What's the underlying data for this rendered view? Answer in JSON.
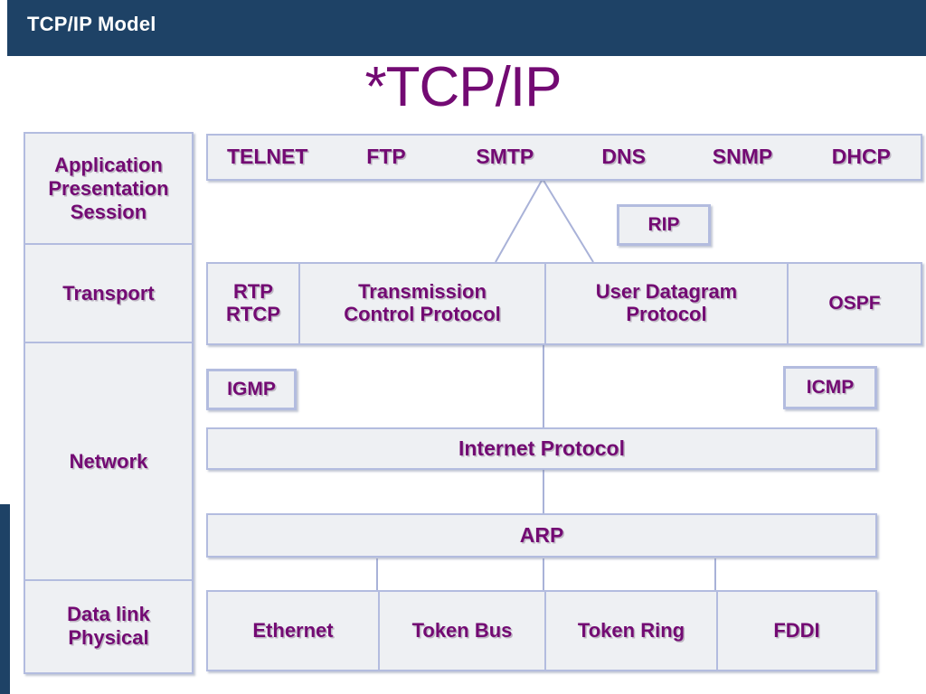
{
  "header": {
    "title": "TCP/IP Model",
    "bar_color": "#1e4266",
    "accent_color": "#730a73"
  },
  "slide": {
    "title": "*TCP/IP"
  },
  "osi_stack": {
    "name": "osi-layer-stack",
    "rows": [
      {
        "label": "Application\nPresentation\nSession"
      },
      {
        "label": "Transport"
      },
      {
        "label": "Network"
      },
      {
        "label": "Data link\nPhysical"
      }
    ]
  },
  "application_row": {
    "items": [
      {
        "label": "TELNET"
      },
      {
        "label": "FTP"
      },
      {
        "label": "SMTP"
      },
      {
        "label": "DNS"
      },
      {
        "label": "SNMP"
      },
      {
        "label": "DHCP"
      }
    ]
  },
  "routing": {
    "rip": {
      "label": "RIP"
    },
    "ospf": {
      "label": "OSPF"
    }
  },
  "transport_row": {
    "items": [
      {
        "label": "RTP\nRTCP"
      },
      {
        "label": "Transmission\nControl Protocol"
      },
      {
        "label": "User Datagram\nProtocol"
      }
    ]
  },
  "network_helpers": {
    "igmp": {
      "label": "IGMP"
    },
    "icmp": {
      "label": "ICMP"
    }
  },
  "internet_protocol": {
    "label": "Internet Protocol"
  },
  "arp": {
    "label": "ARP"
  },
  "link_row": {
    "items": [
      {
        "label": "Ethernet"
      },
      {
        "label": "Token Bus"
      },
      {
        "label": "Token Ring"
      },
      {
        "label": "FDDI"
      }
    ]
  }
}
